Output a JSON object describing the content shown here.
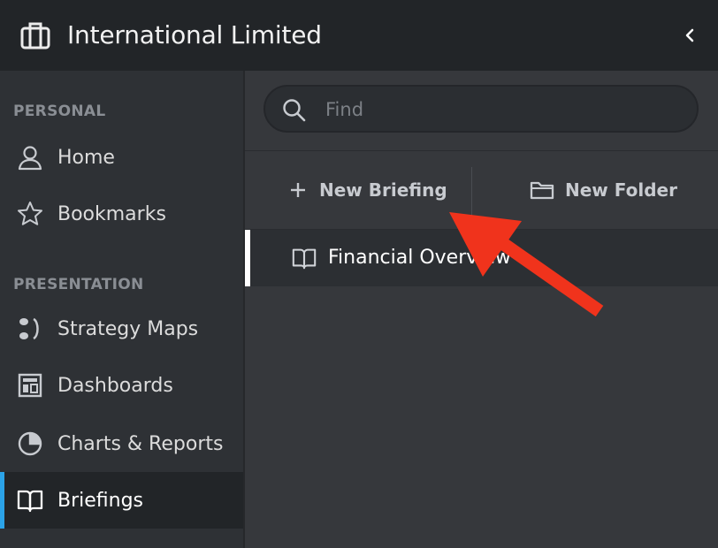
{
  "header": {
    "title": "International Limited"
  },
  "sidebar": {
    "sections": [
      {
        "label": "PERSONAL"
      },
      {
        "label": "PRESENTATION"
      }
    ],
    "items": [
      {
        "label": "Home",
        "icon": "user-icon"
      },
      {
        "label": "Bookmarks",
        "icon": "star-icon"
      },
      {
        "label": "Strategy Maps",
        "icon": "strategy-map-icon"
      },
      {
        "label": "Dashboards",
        "icon": "dashboard-icon"
      },
      {
        "label": "Charts & Reports",
        "icon": "pie-chart-icon"
      },
      {
        "label": "Briefings",
        "icon": "book-icon",
        "active": true
      }
    ]
  },
  "search": {
    "placeholder": "Find",
    "value": ""
  },
  "actions": {
    "new_briefing": "New Briefing",
    "new_folder": "New Folder"
  },
  "briefings": [
    {
      "title": "Financial Overview"
    }
  ],
  "colors": {
    "accent": "#2ba3e8",
    "annotation_arrow": "#f0331c"
  }
}
